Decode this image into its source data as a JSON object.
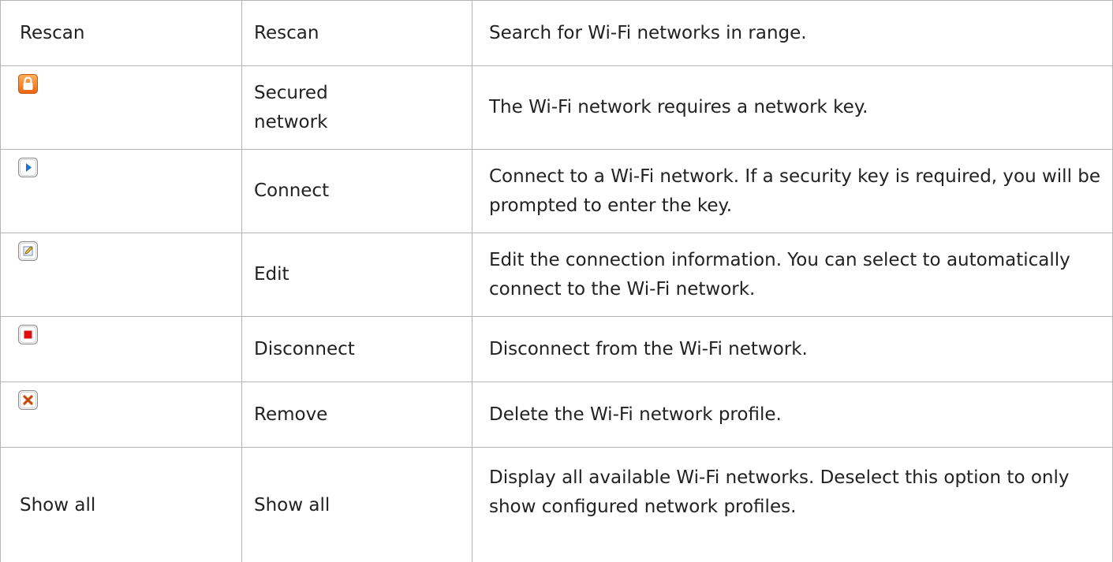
{
  "table": {
    "rows": [
      {
        "col1": "Rescan",
        "icon": null,
        "col2": "Rescan",
        "col3": "Search for Wi-Fi networks in range."
      },
      {
        "col1": "",
        "icon": "lock-icon",
        "col2": "Secured network",
        "col3": "The Wi-Fi network requires a network key."
      },
      {
        "col1": "",
        "icon": "play-icon",
        "col2": "Connect",
        "col3": "Connect to a Wi-Fi network. If a security key is required, you will be prompted to enter the key."
      },
      {
        "col1": "",
        "icon": "edit-icon",
        "col2": "Edit",
        "col3": "Edit the connection information. You can select to automatically connect to the Wi-Fi network."
      },
      {
        "col1": "",
        "icon": "stop-icon",
        "col2": "Disconnect",
        "col3": "Disconnect from the Wi-Fi network."
      },
      {
        "col1": "",
        "icon": "remove-icon",
        "col2": "Remove",
        "col3": "Delete the Wi-Fi network profile."
      },
      {
        "col1": "Show all",
        "icon": null,
        "col2": "Show all",
        "col3": "Display all available Wi-Fi networks. Deselect this option to only show configured network profiles."
      }
    ]
  },
  "colors": {
    "border": "#b5b5b5",
    "text": "#222222",
    "lock_orange": "#f07b1e",
    "play_blue": "#1e6fd6",
    "stop_red": "#e01010",
    "remove_orange": "#e25b17"
  }
}
